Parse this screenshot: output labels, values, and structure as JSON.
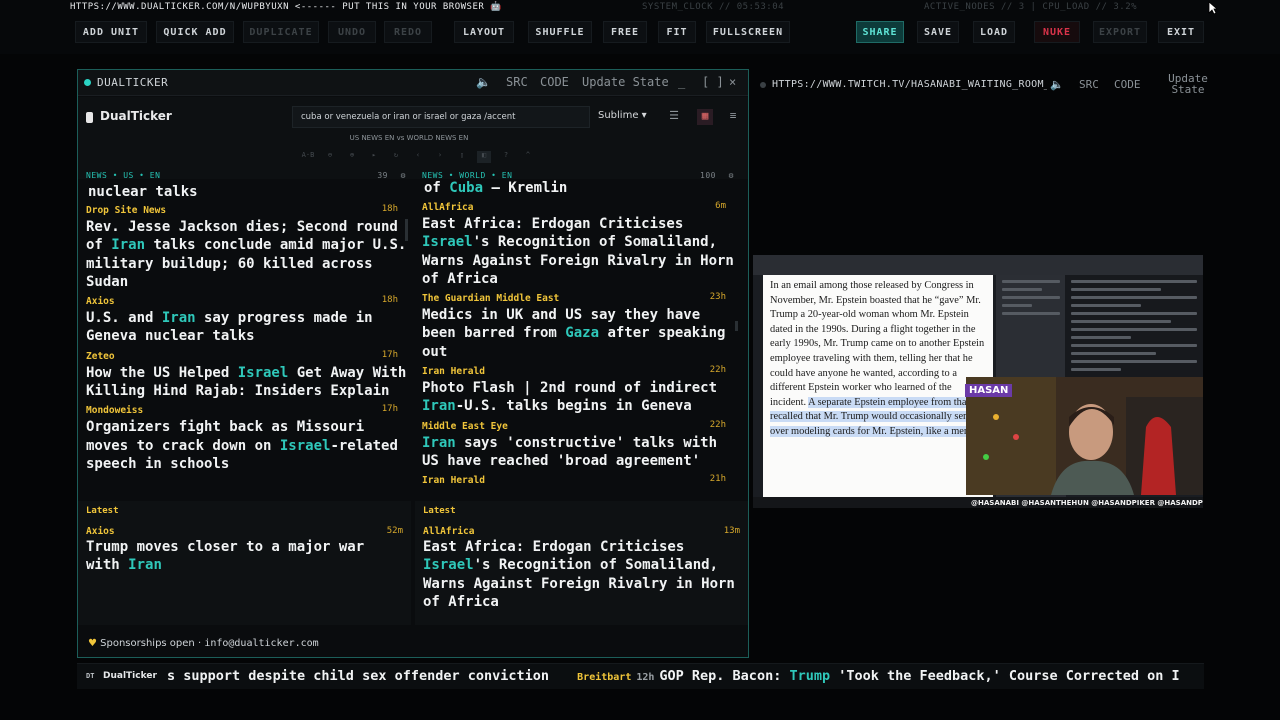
{
  "topstrip": {
    "url_hint": "HTTPS://WWW.DUALTICKER.COM/N/WUPBYUXN <------ PUT THIS IN YOUR BROWSER 🤖",
    "system_clock": "SYSTEM_CLOCK // 05:53:04",
    "nodes": "ACTIVE_NODES // 3 | CPU_LOAD // 3.2%"
  },
  "toolbar": {
    "add_unit": "ADD UNIT",
    "quick_add": "QUICK ADD",
    "duplicate": "DUPLICATE",
    "undo": "UNDO",
    "redo": "REDO",
    "layout": "LAYOUT",
    "shuffle": "SHUFFLE",
    "free": "FREE",
    "fit": "FIT",
    "fullscreen": "FULLSCREEN",
    "share": "SHARE",
    "save": "SAVE",
    "load": "LOAD",
    "nuke": "NUKE",
    "export": "EXPORT",
    "exit": "EXIT"
  },
  "colors": {
    "accent": "#2fc8ba",
    "source": "#f0c53a",
    "nuke": "#d9334a"
  },
  "left_panel": {
    "title": "DUALTICKER",
    "src": "SRC",
    "code": "CODE",
    "update": "Update State",
    "app": {
      "logo": "DualTicker",
      "search": "cuba or venezuela or iran or israel or gaza /accent",
      "preset": "Sublime ▾",
      "compare": "US NEWS EN vs WORLD NEWS EN"
    },
    "col_us": {
      "label": "NEWS • US • EN",
      "count": "39",
      "top_fragment": "nuclear talks",
      "items": [
        {
          "src": "Drop Site News",
          "age": "18h",
          "parts": [
            "Rev. Jesse Jackson dies; Second round of ",
            "Iran",
            " talks conclude amid major U.S. military buildup; 60 killed across Sudan"
          ]
        },
        {
          "src": "Axios",
          "age": "18h",
          "parts": [
            "U.S. and ",
            "Iran",
            " say progress made in Geneva nuclear talks"
          ]
        },
        {
          "src": "Zeteo",
          "age": "17h",
          "parts": [
            "How the US Helped ",
            "Israel",
            " Get Away With Killing Hind Rajab: Insiders Explain"
          ]
        },
        {
          "src": "Mondoweiss",
          "age": "17h",
          "parts": [
            "Organizers fight back as Missouri moves to crack down on ",
            "Israel",
            "-related speech in schools"
          ]
        }
      ]
    },
    "col_world": {
      "label": "NEWS • WORLD • EN",
      "count": "100",
      "top_fragment_a": "of ",
      "top_fragment_kw": "Cuba",
      "top_fragment_b": " — Kremlin",
      "items": [
        {
          "src": "AllAfrica",
          "age": "6m",
          "parts": [
            "East Africa: Erdogan Criticises ",
            "Israel",
            "'s Recognition of Somaliland, Warns Against Foreign Rivalry in Horn of Africa"
          ]
        },
        {
          "src": "The Guardian Middle East",
          "age": "23h",
          "parts": [
            "Medics in UK and US say they have been barred from ",
            "Gaza",
            " after speaking out"
          ]
        },
        {
          "src": "Iran Herald",
          "age": "22h",
          "parts": [
            "Photo Flash | 2nd round of indirect ",
            "Iran",
            "-U.S. talks begins in Geneva"
          ]
        },
        {
          "src": "Middle East Eye",
          "age": "22h",
          "parts": [
            "",
            "Iran",
            " says 'constructive' talks with US have reached 'broad agreement'"
          ]
        },
        {
          "src": "Iran Herald",
          "age": "21h",
          "parts": [
            "",
            "",
            ""
          ]
        }
      ]
    },
    "latest_us": {
      "label": "Latest",
      "src": "Axios",
      "age": "52m",
      "parts": [
        "Trump moves closer to a major war with ",
        "Iran",
        ""
      ]
    },
    "latest_world": {
      "label": "Latest",
      "src": "AllAfrica",
      "age": "13m",
      "parts": [
        "East Africa: Erdogan Criticises ",
        "Israel",
        "'s Recognition of Somaliland, Warns Against Foreign Rivalry in Horn of Africa"
      ]
    },
    "sponsor": "Sponsorships open · ",
    "sponsor_email": "info@dualticker.com"
  },
  "right_panel": {
    "url": "HTTPS://WWW.TWITCH.TV/HASANABI_WAITING_ROOM_",
    "src": "SRC",
    "code": "CODE",
    "update_line1": "Update",
    "update_line2": "State",
    "video": {
      "badge": "HASAN",
      "handles": "@HASANABI @HASANTHEHUN @HASANDPIKER @HASANDPIKER",
      "doc_text_a": "In an email among those released by Congress in November, Mr. Epstein boasted that he “gave” Mr. Trump a 20-year-old woman whom Mr. Epstein dated in the 1990s. During a flight together in the early 1990s, Mr. Trump came on to another Epstein employee traveling with them, telling her that he could have anyone he wanted, according to a different Epstein worker who learned of the incident. ",
      "doc_text_b": "A separate Epstein employee from that era recalled that Mr. Trump would occasionally send over modeling cards for Mr. Epstein, like a menu."
    }
  },
  "ticker": {
    "logo": "DT",
    "name": "DualTicker",
    "text1": "s support despite child sex offender conviction",
    "src2": "Breitbart",
    "age2": "12h",
    "text2a": "GOP Rep. Bacon: ",
    "text2kw": "Trump",
    "text2b": " 'Took the Feedback,' Course Corrected on I"
  }
}
